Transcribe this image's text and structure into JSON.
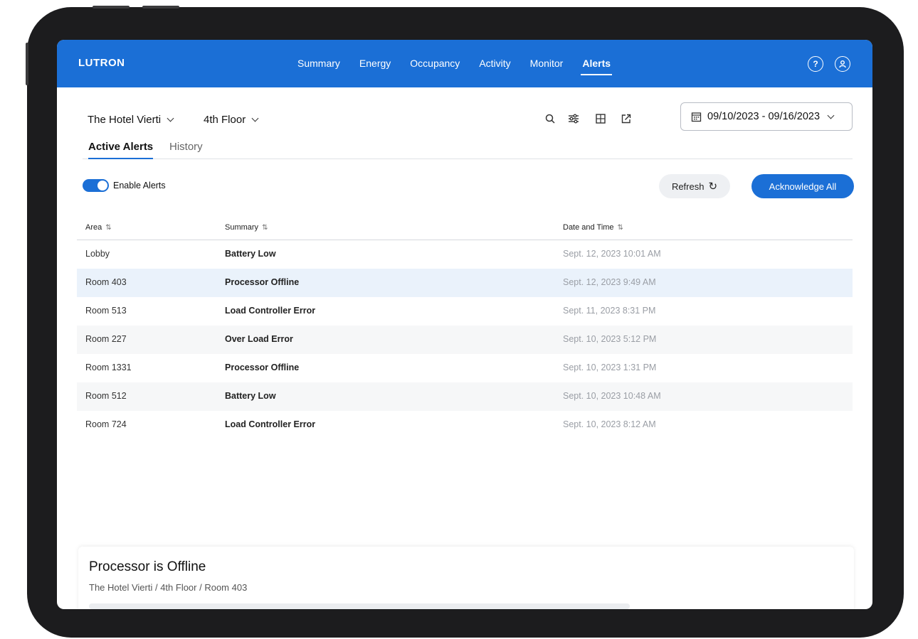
{
  "app": {
    "logo": "LUTRON",
    "nav": [
      "Summary",
      "Energy",
      "Occupancy",
      "Activity",
      "Monitor",
      "Alerts"
    ],
    "active_nav": "Alerts",
    "help_icon": "help-icon",
    "account_icon": "account-icon"
  },
  "toolbar": {
    "property": "The Hotel Vierti",
    "floor": "4th Floor",
    "date_range": "09/10/2023 - 09/16/2023",
    "icons": [
      "search-icon",
      "filter-icon",
      "layout-icon",
      "export-icon"
    ]
  },
  "tabs": {
    "active": "Active Alerts",
    "history": "History"
  },
  "controls": {
    "enable_alerts_label": "Enable Alerts",
    "enable_alerts_on": true,
    "refresh_label": "Refresh",
    "acknowledge_all_label": "Acknowledge All"
  },
  "table": {
    "columns": [
      "Area",
      "Summary",
      "Date and Time"
    ],
    "rows": [
      {
        "area": "Lobby",
        "summary": "Battery Low",
        "date": "Sept. 12, 2023 10:01 AM"
      },
      {
        "area": "Room 403",
        "summary": "Processor Offline",
        "date": "Sept. 12, 2023 9:49 AM"
      },
      {
        "area": "Room 513",
        "summary": "Load Controller Error",
        "date": "Sept. 11, 2023 8:31 PM"
      },
      {
        "area": "Room 227",
        "summary": "Over Load Error",
        "date": "Sept. 10, 2023 5:12 PM"
      },
      {
        "area": "Room 1331",
        "summary": "Processor Offline",
        "date": "Sept. 10, 2023 1:31 PM"
      },
      {
        "area": "Room 512",
        "summary": "Battery Low",
        "date": "Sept. 10, 2023 10:48 AM"
      },
      {
        "area": "Room 724",
        "summary": "Load Controller Error",
        "date": "Sept. 10, 2023 8:12 AM"
      }
    ],
    "selected_row_area": "Room 403"
  },
  "detail": {
    "title": "Processor is Offline",
    "path": "The Hotel Vierti / 4th Floor / Room 403"
  },
  "colors": {
    "brand": "#1b6fd6",
    "selected_row": "#eaf2fb",
    "alt_row": "#f6f7f8"
  }
}
